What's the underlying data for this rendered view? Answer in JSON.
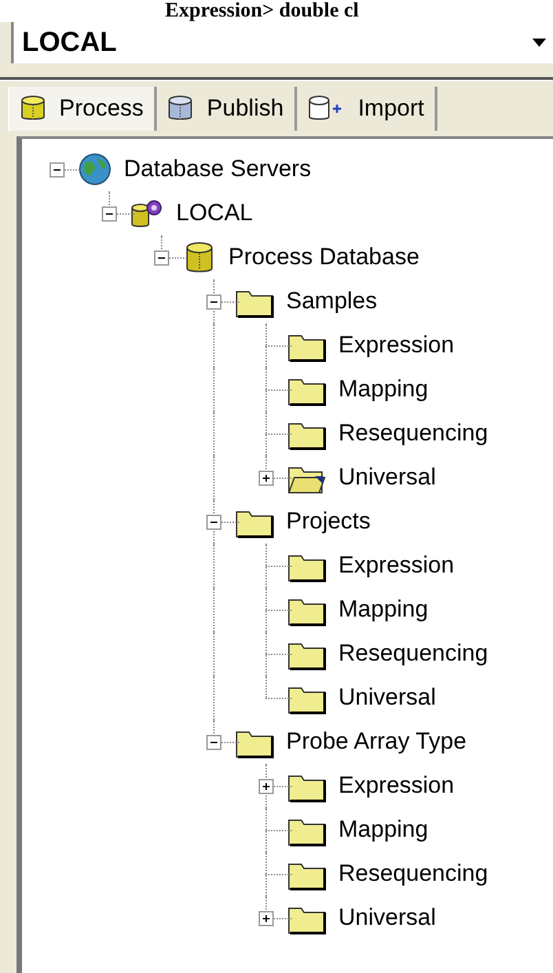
{
  "document_text": "Expression> double cl",
  "server_select": {
    "value": "LOCAL"
  },
  "tabs": [
    {
      "label": "Process",
      "kind": "process",
      "selected": true
    },
    {
      "label": "Publish",
      "kind": "publish",
      "selected": false
    },
    {
      "label": "Import",
      "kind": "import",
      "selected": false
    }
  ],
  "tree": {
    "nodes": [
      {
        "label": "Database Servers",
        "kind": "globe",
        "expanded": true,
        "children": [
          {
            "label": "LOCAL",
            "kind": "server",
            "expanded": true,
            "children": [
              {
                "label": "Process Database",
                "kind": "database",
                "expanded": true,
                "children": [
                  {
                    "label": "Samples",
                    "kind": "folder",
                    "expanded": true,
                    "children": [
                      {
                        "label": "Expression",
                        "kind": "folder"
                      },
                      {
                        "label": "Mapping",
                        "kind": "folder"
                      },
                      {
                        "label": "Resequencing",
                        "kind": "folder"
                      },
                      {
                        "label": "Universal",
                        "kind": "folder-open",
                        "expanded": false
                      }
                    ]
                  },
                  {
                    "label": "Projects",
                    "kind": "folder",
                    "expanded": true,
                    "children": [
                      {
                        "label": "Expression",
                        "kind": "folder"
                      },
                      {
                        "label": "Mapping",
                        "kind": "folder"
                      },
                      {
                        "label": "Resequencing",
                        "kind": "folder"
                      },
                      {
                        "label": "Universal",
                        "kind": "folder"
                      }
                    ]
                  },
                  {
                    "label": "Probe Array Type",
                    "kind": "folder",
                    "expanded": true,
                    "children": [
                      {
                        "label": "Expression",
                        "kind": "folder",
                        "expanded": false
                      },
                      {
                        "label": "Mapping",
                        "kind": "folder"
                      },
                      {
                        "label": "Resequencing",
                        "kind": "folder"
                      },
                      {
                        "label": "Universal",
                        "kind": "folder",
                        "expanded": false
                      }
                    ]
                  }
                ]
              }
            ]
          }
        ]
      }
    ]
  }
}
